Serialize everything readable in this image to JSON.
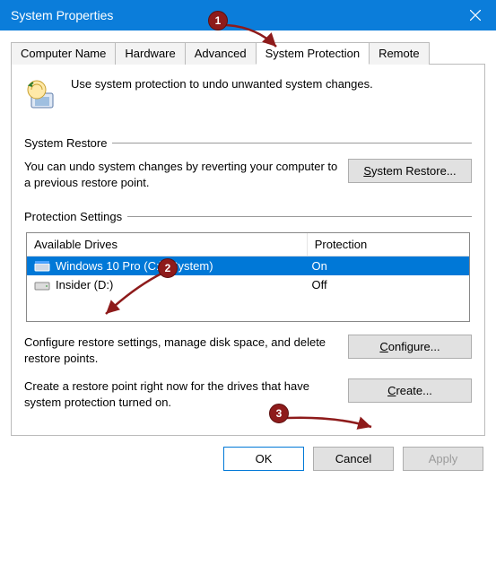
{
  "window": {
    "title": "System Properties"
  },
  "tabs": {
    "computer_name": "Computer Name",
    "hardware": "Hardware",
    "advanced": "Advanced",
    "system_protection": "System Protection",
    "remote": "Remote"
  },
  "intro": {
    "text": "Use system protection to undo unwanted system changes."
  },
  "system_restore": {
    "group_label": "System Restore",
    "text": "You can undo system changes by reverting your computer to a previous restore point.",
    "button_prefix": "S",
    "button_rest": "ystem Restore..."
  },
  "protection_settings": {
    "group_label": "Protection Settings",
    "col_drives": "Available Drives",
    "col_protection": "Protection",
    "drives": [
      {
        "name": "Windows 10 Pro (C:) (System)",
        "protection": "On",
        "selected": true
      },
      {
        "name": "Insider (D:)",
        "protection": "Off",
        "selected": false
      }
    ],
    "configure_text": "Configure restore settings, manage disk space, and delete restore points.",
    "configure_btn_prefix": "C",
    "configure_btn_rest": "onfigure...",
    "create_text": "Create a restore point right now for the drives that have system protection turned on.",
    "create_btn_prefix": "C",
    "create_btn_rest": "reate..."
  },
  "footer": {
    "ok": "OK",
    "cancel": "Cancel",
    "apply": "Apply"
  },
  "annotations": {
    "n1": "1",
    "n2": "2",
    "n3": "3"
  }
}
